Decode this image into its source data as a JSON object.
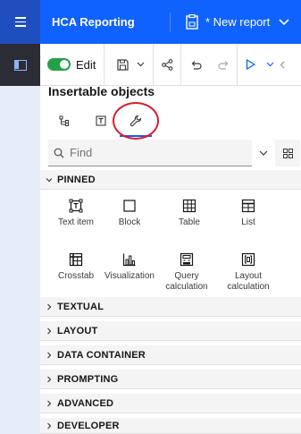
{
  "topbar": {
    "app_title": "HCA Reporting",
    "report_name": "* New report"
  },
  "toolbar": {
    "edit_label": "Edit"
  },
  "panel": {
    "title": "Insertable objects",
    "tabs": [
      {
        "icon": "source-tree-icon"
      },
      {
        "icon": "text-frame-icon"
      },
      {
        "icon": "toolbox-wrench-icon",
        "active": true
      }
    ]
  },
  "search": {
    "placeholder": "Find"
  },
  "sections": {
    "pinned": "PINNED",
    "textual": "TEXTUAL",
    "layout": "LAYOUT",
    "data_container": "DATA CONTAINER",
    "prompting": "PROMPTING",
    "advanced": "ADVANCED",
    "developer": "DEVELOPER"
  },
  "pinned_items": [
    {
      "label": "Text item",
      "icon": "text-item-icon"
    },
    {
      "label": "Block",
      "icon": "block-icon"
    },
    {
      "label": "Table",
      "icon": "table-icon"
    },
    {
      "label": "List",
      "icon": "list-icon"
    },
    {
      "label": "Crosstab",
      "icon": "crosstab-icon"
    },
    {
      "label": "Visualization",
      "icon": "visualization-icon"
    },
    {
      "label": "Query calculation",
      "icon": "query-calculation-icon"
    },
    {
      "label": "Layout calculation",
      "icon": "layout-calculation-icon"
    }
  ],
  "colors": {
    "brand_blue": "#0f62fe",
    "toggle_green": "#24a148",
    "annotation_red": "#da1e28"
  }
}
